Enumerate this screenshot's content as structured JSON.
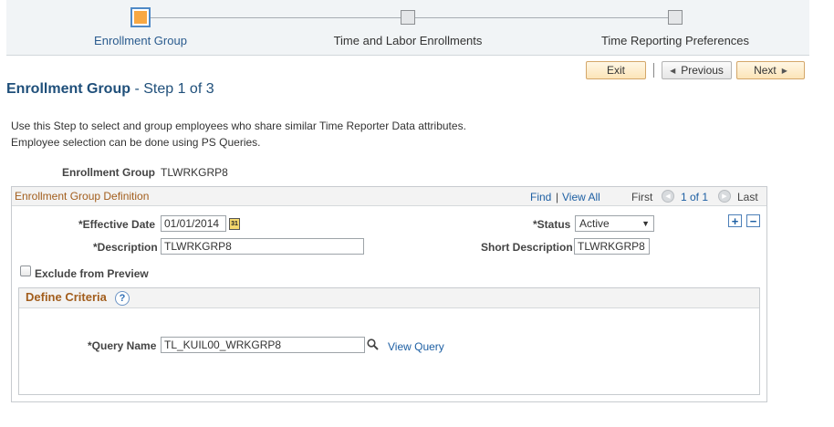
{
  "train": {
    "steps": [
      {
        "label": "Enrollment Group",
        "active": true
      },
      {
        "label": "Time and Labor Enrollments",
        "active": false
      },
      {
        "label": "Time Reporting Preferences",
        "active": false
      }
    ]
  },
  "toolbar": {
    "exit_label": "Exit",
    "previous_label": "Previous",
    "next_label": "Next"
  },
  "page": {
    "title": "Enrollment Group",
    "step_text": "- Step 1 of 3",
    "instructions_line1": "Use this Step to select and group employees who share similar Time Reporter Data attributes.",
    "instructions_line2": "Employee selection can be done using PS Queries."
  },
  "header_fields": {
    "enrollment_group_label": "Enrollment Group",
    "enrollment_group_value": "TLWRKGRP8"
  },
  "definition": {
    "title": "Enrollment Group Definition",
    "find_label": "Find",
    "separator": "|",
    "view_all_label": "View All",
    "first_label": "First",
    "page_indicator": "1 of 1",
    "last_label": "Last",
    "add_row_label": "+",
    "delete_row_label": "−",
    "effective_date_label": "*Effective Date",
    "effective_date_value": "01/01/2014",
    "calendar_icon_text": "31",
    "status_label": "*Status",
    "status_value": "Active",
    "description_label": "*Description",
    "description_value": "TLWRKGRP8",
    "short_description_label": "Short Description",
    "short_description_value": "TLWRKGRP8",
    "exclude_label": "Exclude from Preview",
    "exclude_checked": false
  },
  "criteria": {
    "title": "Define Criteria",
    "help_icon_text": "?",
    "query_name_label": "*Query Name",
    "query_name_value": "TL_KUIL00_WRKGRP8",
    "view_query_label": "View Query"
  },
  "colors": {
    "accent": "#f8a843",
    "link": "#1d5fa3",
    "section_title": "#a25d1c",
    "page_title": "#1f4f7a"
  }
}
